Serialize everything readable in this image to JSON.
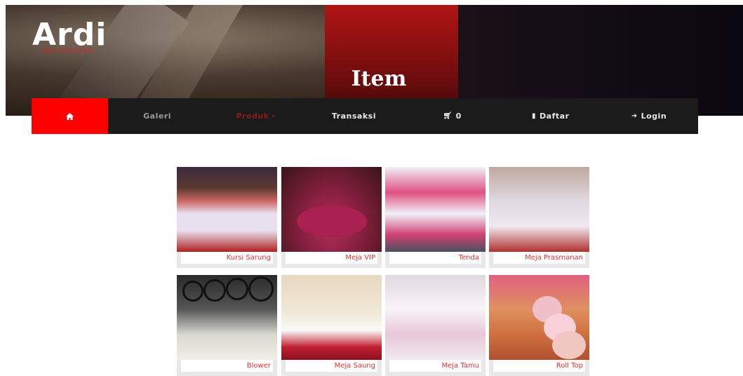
{
  "header": {
    "logo_main": "Ardi",
    "logo_sub": "Decoration",
    "page_title": "Item"
  },
  "nav": {
    "home_icon": "home-icon",
    "galeri": "Galeri",
    "produk": "Produk",
    "transaksi": "Transaksi",
    "cart_count": "0",
    "daftar": "Daftar",
    "login": "Login"
  },
  "items": [
    {
      "name": "Kursi Sarung"
    },
    {
      "name": "Meja VIP"
    },
    {
      "name": "Tenda"
    },
    {
      "name": "Meja Prasmanan"
    },
    {
      "name": "Blower"
    },
    {
      "name": "Meja Saung"
    },
    {
      "name": "Meja Tamu"
    },
    {
      "name": "Roll Top"
    }
  ],
  "colors": {
    "accent": "#ff0000",
    "navbar": "#1b1b1b",
    "caption_text": "#e83232"
  }
}
